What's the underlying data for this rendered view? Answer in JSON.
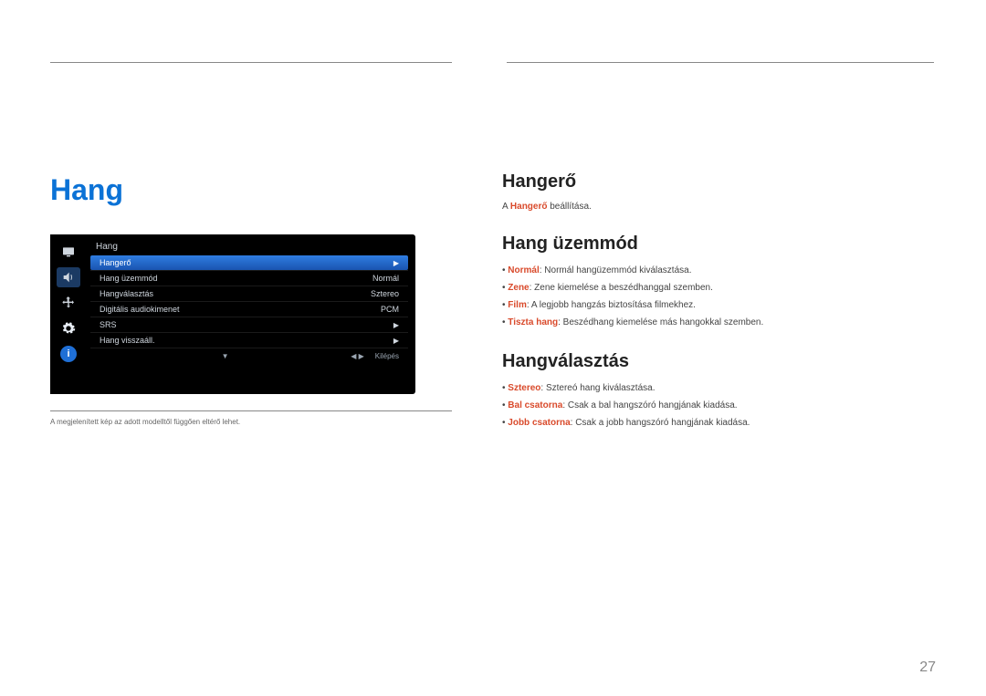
{
  "page_number": "27",
  "left": {
    "title": "Hang",
    "footnote": "A megjelenített kép az adott modelltől függően eltérő lehet."
  },
  "osd": {
    "title": "Hang",
    "rows": [
      {
        "label": "Hangerő",
        "value": "",
        "arrow": "▶",
        "hl": true
      },
      {
        "label": "Hang üzemmód",
        "value": "Normál",
        "arrow": "",
        "hl": false
      },
      {
        "label": "Hangválasztás",
        "value": "Sztereo",
        "arrow": "",
        "hl": false
      },
      {
        "label": "Digitális audiokimenet",
        "value": "PCM",
        "arrow": "",
        "hl": false
      },
      {
        "label": "SRS",
        "value": "",
        "arrow": "▶",
        "hl": false
      },
      {
        "label": "Hang visszaáll.",
        "value": "",
        "arrow": "▶",
        "hl": false
      }
    ],
    "foot_center": "▼",
    "foot_right_nav": "◀    ▶",
    "foot_right_exit": "Kilépés"
  },
  "right": {
    "sec1": {
      "heading": "Hangerő",
      "line": "A Hangerő beállítása."
    },
    "sec2": {
      "heading": "Hang üzemmód",
      "items": [
        {
          "bold": "Normál",
          "rest": ": Normál hangüzemmód kiválasztása."
        },
        {
          "bold": "Zene",
          "rest": ": Zene kiemelése a beszédhanggal szemben."
        },
        {
          "bold": "Film",
          "rest": ": A legjobb hangzás biztosítása filmekhez."
        },
        {
          "bold": "Tiszta hang",
          "rest": ": Beszédhang kiemelése más hangokkal szemben."
        }
      ]
    },
    "sec3": {
      "heading": "Hangválasztás",
      "items": [
        {
          "bold": "Sztereo",
          "rest": ": Sztereó hang kiválasztása."
        },
        {
          "bold": "Bal csatorna",
          "rest": ": Csak a bal hangszóró hangjának kiadása."
        },
        {
          "bold": "Jobb csatorna",
          "rest": ": Csak a jobb hangszóró hangjának kiadása."
        }
      ]
    }
  }
}
